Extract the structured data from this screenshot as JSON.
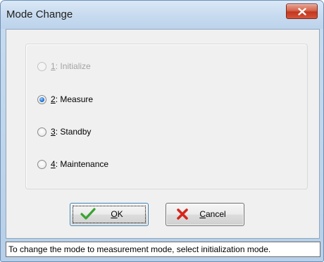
{
  "window": {
    "title": "Mode Change"
  },
  "modes": {
    "options": [
      {
        "key": "1",
        "rest": ": Initialize",
        "enabled": false,
        "selected": false
      },
      {
        "key": "2",
        "rest": ": Measure",
        "enabled": true,
        "selected": true
      },
      {
        "key": "3",
        "rest": ": Standby",
        "enabled": true,
        "selected": false
      },
      {
        "key": "4",
        "rest": ": Maintenance",
        "enabled": true,
        "selected": false
      }
    ]
  },
  "buttons": {
    "ok": {
      "mnemonic": "O",
      "rest": "K",
      "icon": "checkmark-icon"
    },
    "cancel": {
      "mnemonic": "C",
      "rest": "ancel",
      "icon": "x-mark-icon"
    }
  },
  "status": {
    "text": "To change the mode to measurement mode, select initialization mode."
  },
  "colors": {
    "title_bar": "#c8dbef",
    "close_button": "#c2371e",
    "ok_icon": "#3aa331",
    "cancel_icon": "#d6251b"
  }
}
